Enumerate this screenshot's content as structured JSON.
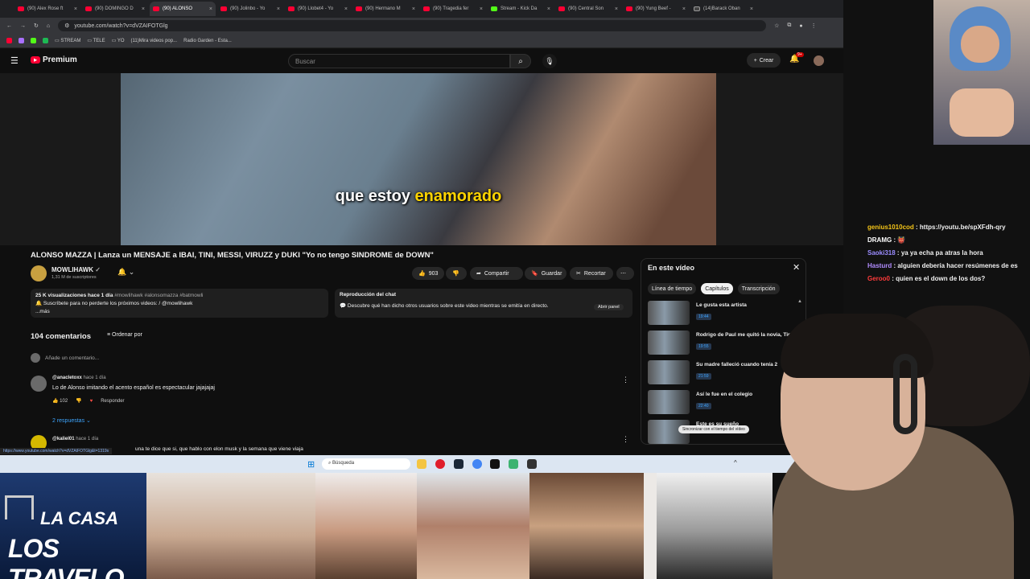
{
  "browser": {
    "tabs": [
      {
        "label": "(90) Alex Rose ft",
        "fav": "red"
      },
      {
        "label": "(90) DOMINGO D",
        "fav": "red"
      },
      {
        "label": "(90) ALONSO",
        "fav": "red",
        "active": true
      },
      {
        "label": "(90) Jolinbo - Yo",
        "fav": "red"
      },
      {
        "label": "(90) Llobet4 - Yo",
        "fav": "red"
      },
      {
        "label": "(90) Hermano M",
        "fav": "red"
      },
      {
        "label": "(90) Tragedia fer",
        "fav": "red"
      },
      {
        "label": "Stream - Kick Da",
        "fav": "green"
      },
      {
        "label": "(90) Central Son",
        "fav": "red"
      },
      {
        "label": "(90) Yung Beef -",
        "fav": "red"
      },
      {
        "label": "(14)Barack Oban",
        "fav": "dark"
      }
    ],
    "url": "youtube.com/watch?v=dVZAIFOTGlg",
    "bookmarks": [
      "STREAM",
      "TELE",
      "YO",
      "(11)Mira videos pop...",
      "Radio Garden - Esta..."
    ],
    "status_url": "https://www.youtube.com/watch?v=dVZAIFOTGlg&t=1319s"
  },
  "youtube": {
    "logo_text": "Premium",
    "search_placeholder": "Buscar",
    "create_label": "Crear",
    "notif_count": "9+",
    "subtitle_pre": "que estoy ",
    "subtitle_hl": "enamorado",
    "video_title": "ALONSO MAZZA | Lanza un MENSAJE a IBAI, TINI, MESSI, VIRUZZ y DUKI \"Yo no tengo SINDROME de DOWN\"",
    "channel_name": "MOWLIHAWK",
    "subscribers": "1,31 M de suscriptores",
    "likes": "903",
    "share_label": "Compartir",
    "save_label": "Guardar",
    "clip_label": "Recortar",
    "desc_line1": "25 K visualizaciones  hace 1 día",
    "desc_tags": " #mowlihawk #alonsomazza #batmowli",
    "desc_line2": "🔔 Suscríbete para no perderte los próximos videos: ",
    "desc_line2b": "/ @mowlihawk",
    "desc_more": "...más",
    "chat_title": "Reproducción del chat",
    "chat_desc": "Descubre qué han dicho otros usuarios sobre este video mientras se emitía en directo.",
    "chat_button": "Abrir panel",
    "comments_count": "104 comentarios",
    "sort_label": "Ordenar por",
    "add_comment": "Añade un comentario...",
    "comments": [
      {
        "user": "@anacletoxx",
        "time": "hace 1 día",
        "text": "Lo de Alonso imitando el acento español es espectacular jajajajaj",
        "likes": "102",
        "reply": "Responder",
        "replies": "2 respuestas"
      },
      {
        "user": "@kaliel01",
        "time": "hace 1 día",
        "text": "una te dice que si, que hablo con elon musk y la semana que viene viaja"
      }
    ]
  },
  "chapters": {
    "title": "En este vídeo",
    "tabs": [
      "Línea de tiempo",
      "Capítulos",
      "Transcripción"
    ],
    "items": [
      {
        "title": "Le gusta esta artista",
        "time": "19:44"
      },
      {
        "title": "Rodrigo de Paul me quitó la novia, Tini",
        "time": "19:55"
      },
      {
        "title": "Su madre falleció cuando tenía 2",
        "time": "21:59"
      },
      {
        "title": "Así le fue en el colegio",
        "time": "22:40"
      },
      {
        "title": "Este es su sueño",
        "time": ""
      }
    ],
    "sync_label": "Sincronizar con el tiempo del vídeo"
  },
  "taskbar": {
    "search": "Búsqueda"
  },
  "twitch_chat": [
    {
      "user": "genius1010cod",
      "color": "#f5c518",
      "msg": "https://youtu.be/spXFdh-qry"
    },
    {
      "user": "DRAMG",
      "color": "#ffffff",
      "msg": "👹"
    },
    {
      "user": "Saoki318",
      "color": "#9b8cff",
      "msg": "ya ya echa pa atras la hora"
    },
    {
      "user": "Hasturd",
      "color": "#b18cff",
      "msg": "alguien debería hacer resúmenes de es"
    },
    {
      "user": "Geroo0",
      "color": "#ff3b3b",
      "msg": "quien es el down de los dos?"
    }
  ],
  "overlay": {
    "banner_line1": "LA CASA",
    "banner_line2": "LOS TRAVELO"
  }
}
